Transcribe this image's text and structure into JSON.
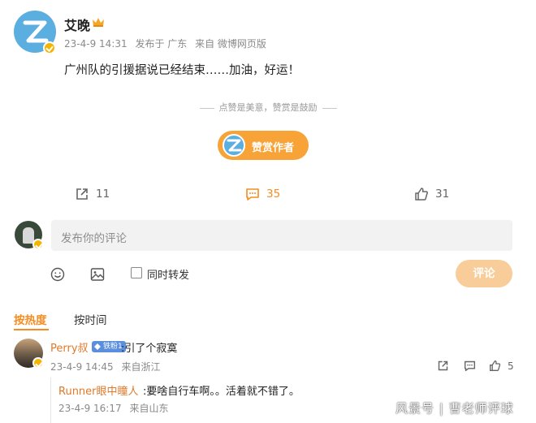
{
  "post": {
    "author": "艾晚",
    "time": "23-4-9 14:31",
    "location": "发布于 广东",
    "source": "来自 微博网页版",
    "text": "广州队的引援据说已经结束……加油，好运！"
  },
  "reward": {
    "tip": "点赞是美意，赞赏是鼓励",
    "button_label": "赞赏作者"
  },
  "actions": {
    "forward_count": "11",
    "comment_count": "35",
    "like_count": "31"
  },
  "composer": {
    "placeholder": "发布你的评论",
    "repost_label": "同时转发",
    "submit_label": "评论"
  },
  "sort": {
    "hot_label": "按热度",
    "time_label": "按时间"
  },
  "comments": [
    {
      "author": "Perry叔",
      "badge": "铁粉1",
      "text": ":引了个寂寞",
      "time": "23-4-9 14:45",
      "location": "来自浙江",
      "like_count": "5",
      "reply": {
        "author": "Runner眼中瞳人",
        "text": ":要啥自行车啊。。活着就不错了。",
        "time": "23-4-9 16:17",
        "location": "来自山东"
      }
    }
  ],
  "watermark": "风景号 | 曹老师评球",
  "colors": {
    "accent": "#f78b1f",
    "reward_button": "#f7a337",
    "submit_disabled": "#f8cd9a",
    "avatar_blue": "#5aaee0",
    "name_link": "#e07a2a"
  },
  "icons": [
    "verified-badge-icon",
    "crown-icon",
    "forward-icon",
    "comment-icon",
    "like-icon",
    "emoji-icon",
    "image-icon"
  ]
}
